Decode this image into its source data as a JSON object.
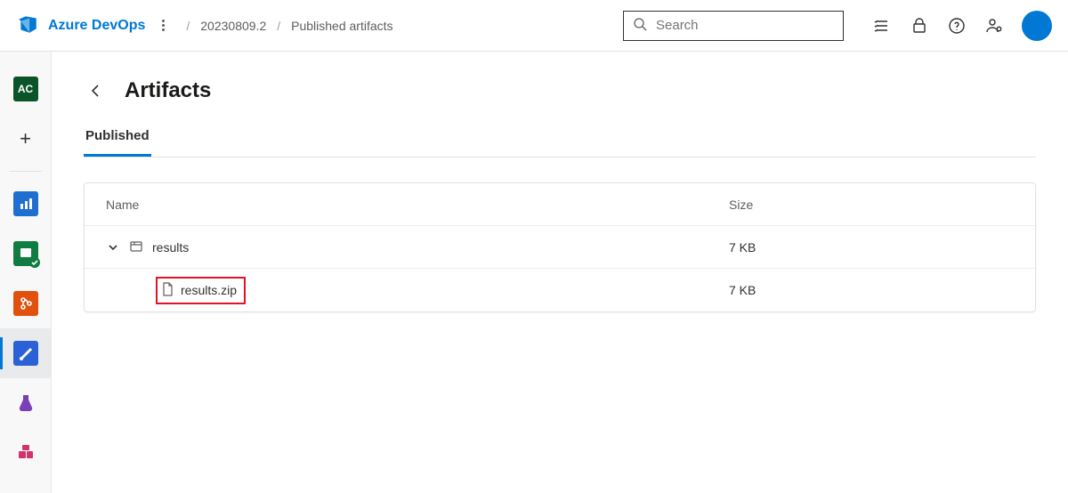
{
  "header": {
    "product": "Azure DevOps",
    "breadcrumb": [
      "20230809.2",
      "Published artifacts"
    ],
    "search_placeholder": "Search"
  },
  "sidebar": {
    "project_initials": "AC"
  },
  "page": {
    "title": "Artifacts",
    "tabs": [
      "Published"
    ],
    "active_tab": 0,
    "columns": {
      "name": "Name",
      "size": "Size"
    },
    "artifacts": [
      {
        "name": "results",
        "size": "7 KB",
        "expanded": true,
        "children": [
          {
            "name": "results.zip",
            "size": "7 KB",
            "highlighted": true
          }
        ]
      }
    ]
  }
}
